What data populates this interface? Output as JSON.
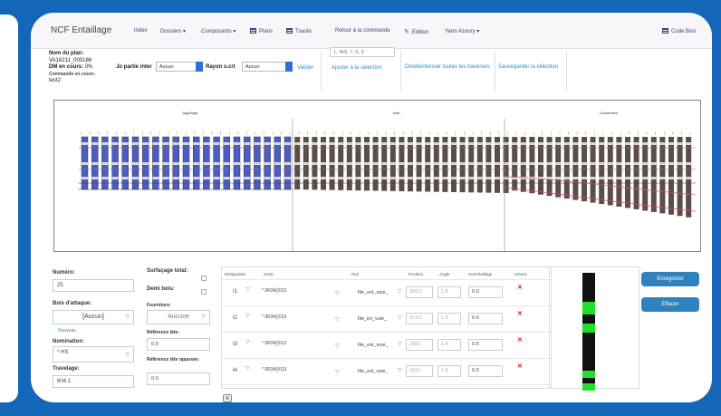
{
  "nav": {
    "brand": "NCF Entaillage",
    "items": [
      {
        "label": "Index"
      },
      {
        "label": "Dossiers ▾"
      },
      {
        "label": "Composants ▾"
      },
      {
        "label": "Plans"
      },
      {
        "label": "Tracés"
      },
      {
        "label": "Retour à la commande"
      },
      {
        "label": "Edition"
      },
      {
        "label": "Yann Azoury ▾"
      }
    ],
    "right_label": "Code Bois"
  },
  "info": {
    "plan_label": "Nom du plan:",
    "plan_value": "VA16211_000186",
    "dm_label": "DM en cours:",
    "dm_value": "0%",
    "cmd_label": "Commande en cours:",
    "cmd_value": "test2"
  },
  "toolbar": {
    "jo_label": "Jo partie inter",
    "jo_value": "Aucun",
    "rayon_label": "Rayon s.crt",
    "rayon_value": "Aucun",
    "validate": "Valider",
    "coord_placeholder": "1, 458, 7, 6, 9",
    "add_selection": "Ajouter à la sélection",
    "deselect": "Désélectionner toutes les traverses",
    "save_selection": "Sauvegarder la sélection"
  },
  "plan": {
    "section_labels": [
      "Aiguillage",
      "Inter",
      "Croisement"
    ]
  },
  "form": {
    "numero_label": "Numéro:",
    "numero_value": "25",
    "bois_label": "Bois d'attaque:",
    "bois_value": "[Aucun]",
    "bois_link": "Nouveau",
    "nomination_label": "Nomination:",
    "nomination_value": "* HS",
    "travelage_label": "Travelage:",
    "travelage_value": "604.1",
    "surfacage_label": "Surfaçage total:",
    "demi_bois_label": "Demi bois:",
    "fourniture_label": "Fourniture:",
    "fourniture_value": "Aucune",
    "ref_tete_label": "Référence tête:",
    "ref_tete_value": "0.0",
    "ref_opposee_label": "Référence tête opposée:",
    "ref_opposee_value": "0.0"
  },
  "table": {
    "headers": [
      "Désignation",
      "Sorte",
      "Rail",
      "Position",
      "Angle",
      "Surentaillage",
      "Actions"
    ],
    "rows": [
      {
        "designation": "I1",
        "sorte": "* 0R34▒013",
        "rail": "file_ext_voie_",
        "position": "368.5",
        "angle": "1.8",
        "surentaillage": "0.0"
      },
      {
        "designation": "I2",
        "sorte": "* 0R34▒013",
        "rail": "file_int_voie_",
        "position": "973.5",
        "angle": "1.8",
        "surentaillage": "0.0"
      },
      {
        "designation": "I3",
        "sorte": "* 0R34▒013",
        "rail": "file_ext_voie_",
        "position": "2005",
        "angle": "1.8",
        "surentaillage": "0.0"
      },
      {
        "designation": "I4",
        "sorte": "* 0R34▒013",
        "rail": "file_ext_voie_",
        "position": "2411",
        "angle": "1.8",
        "surentaillage": "0.0"
      }
    ]
  },
  "buttons": {
    "primary": "Enregistrer",
    "secondary": "Effacer"
  },
  "colors": {
    "background": "#1466b8",
    "accent": "#2f82be",
    "tie_brown": "#5c4d48",
    "tie_selected": "#4d5cc4",
    "highlight_green": "#22e02a"
  }
}
